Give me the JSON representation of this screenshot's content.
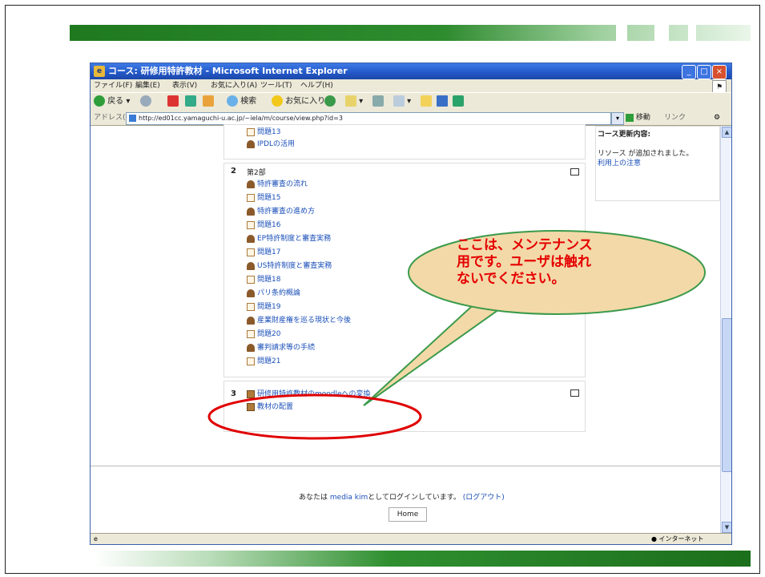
{
  "browser": {
    "title": "コース: 研修用特許教材 - Microsoft Internet Explorer",
    "menu": [
      "ファイル(F)",
      "編集(E)",
      "表示(V)",
      "お気に入り(A)",
      "ツール(T)",
      "ヘルプ(H)"
    ],
    "toolbar": {
      "back": "戻る",
      "search": "検索",
      "favorites": "お気に入り"
    },
    "address_label": "アドレス(D)",
    "url": "http://ed01cc.yamaguchi-u.ac.jp/~iela/m/course/view.php?id=3",
    "go": "移動",
    "links": "リンク",
    "status_zone": "インターネット"
  },
  "course": {
    "top_items": [
      {
        "icon": "quiz-icon",
        "label": "問題13"
      },
      {
        "icon": "resource-icon",
        "label": "IPDLの活用"
      }
    ],
    "section2": {
      "number": "2",
      "title": "第2部",
      "items": [
        {
          "icon": "resource-icon",
          "label": "特許審査の流れ"
        },
        {
          "icon": "quiz-icon",
          "label": "問題15"
        },
        {
          "icon": "resource-icon",
          "label": "特許審査の進め方"
        },
        {
          "icon": "quiz-icon",
          "label": "問題16"
        },
        {
          "icon": "resource-icon",
          "label": "EP特許制度と審査実務"
        },
        {
          "icon": "quiz-icon",
          "label": "問題17"
        },
        {
          "icon": "resource-icon",
          "label": "US特許制度と審査実務"
        },
        {
          "icon": "quiz-icon",
          "label": "問題18"
        },
        {
          "icon": "resource-icon",
          "label": "パリ条約概論"
        },
        {
          "icon": "quiz-icon",
          "label": "問題19"
        },
        {
          "icon": "resource-icon",
          "label": "産業財産権を巡る現状と今後"
        },
        {
          "icon": "quiz-icon",
          "label": "問題20"
        },
        {
          "icon": "resource-icon",
          "label": "審判請求等の手続"
        },
        {
          "icon": "quiz-icon",
          "label": "問題21"
        }
      ]
    },
    "section3": {
      "number": "3",
      "items": [
        {
          "icon": "module-icon",
          "label": "研修用特許教材のmoodleへの変換"
        },
        {
          "icon": "module-icon",
          "label": "教材の配置"
        }
      ]
    }
  },
  "sidebar": {
    "heading": "コース更新内容:",
    "line1": "リソース が追加されました。",
    "link": "利用上の注意"
  },
  "footer": {
    "login_prefix": "あなたは",
    "user": "media kim",
    "login_mid": "としてログインしています。",
    "logout": "(ログアウト)",
    "home": "Home"
  },
  "callout": {
    "lines": [
      "ここは、メンテナンス",
      "用です。ユーザは触れ",
      "ないでください。"
    ]
  },
  "colors": {
    "callout_text": "#e50000",
    "callout_fill": "#f3d9a8",
    "callout_border": "#3a9a4a",
    "highlight_ellipse": "#e00000",
    "green_bar": "#2e8b2e"
  }
}
